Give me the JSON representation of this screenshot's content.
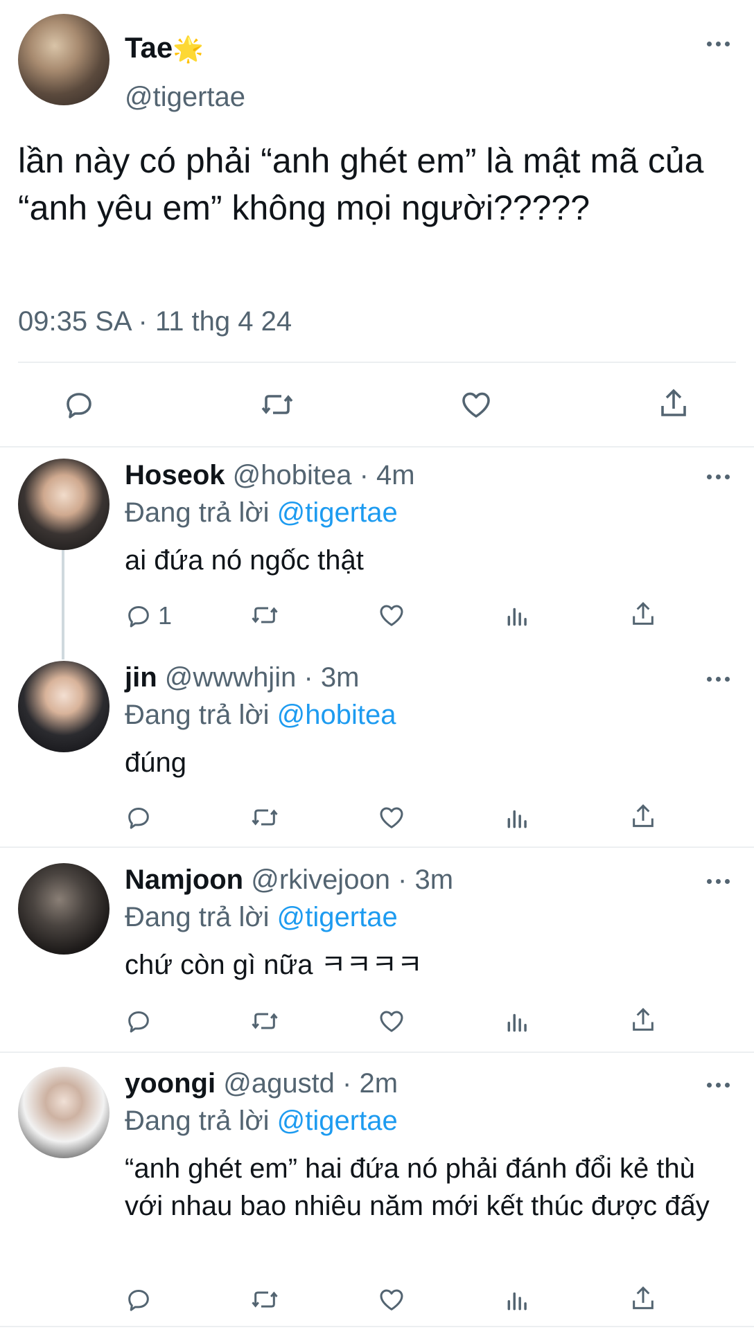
{
  "main_tweet": {
    "name": "Tae",
    "badge": "🌟",
    "handle": "@tigertae",
    "text": "lần này có phải “anh ghét em” là mật mã của “anh yêu em” không mọi người?????",
    "timestamp": "09:35 SA · 11 thg 4 24"
  },
  "replies": [
    {
      "name": "Hoseok",
      "meta": "@hobitea · 4m",
      "replying_label": "Đang trả lời",
      "replying_to": "@tigertae",
      "text": "ai đứa nó ngốc thật",
      "reply_count": "1"
    },
    {
      "name": "jin",
      "meta": "@wwwhjin · 3m",
      "replying_label": "Đang trả lời",
      "replying_to": "@hobitea",
      "text": "đúng",
      "reply_count": ""
    },
    {
      "name": "Namjoon",
      "meta": "@rkivejoon · 3m",
      "replying_label": "Đang trả lời",
      "replying_to": "@tigertae",
      "text": "chứ còn gì nữa ㅋㅋㅋㅋ",
      "reply_count": ""
    },
    {
      "name": "yoongi",
      "meta": "@agustd · 2m",
      "replying_label": "Đang trả lời",
      "replying_to": "@tigertae",
      "text": "“anh ghét em” hai đứa nó phải đánh đổi kẻ thù với nhau bao nhiêu năm mới kết thúc được đấy",
      "reply_count": ""
    }
  ],
  "icons": {
    "reply": "comment-icon",
    "retweet": "retweet-icon",
    "like": "heart-icon",
    "views": "analytics-icon",
    "share": "share-icon",
    "more": "more-icon"
  },
  "colors": {
    "text": "#0f1419",
    "secondary": "#536471",
    "accent": "#1d9bf0",
    "divider": "#eceff1"
  }
}
